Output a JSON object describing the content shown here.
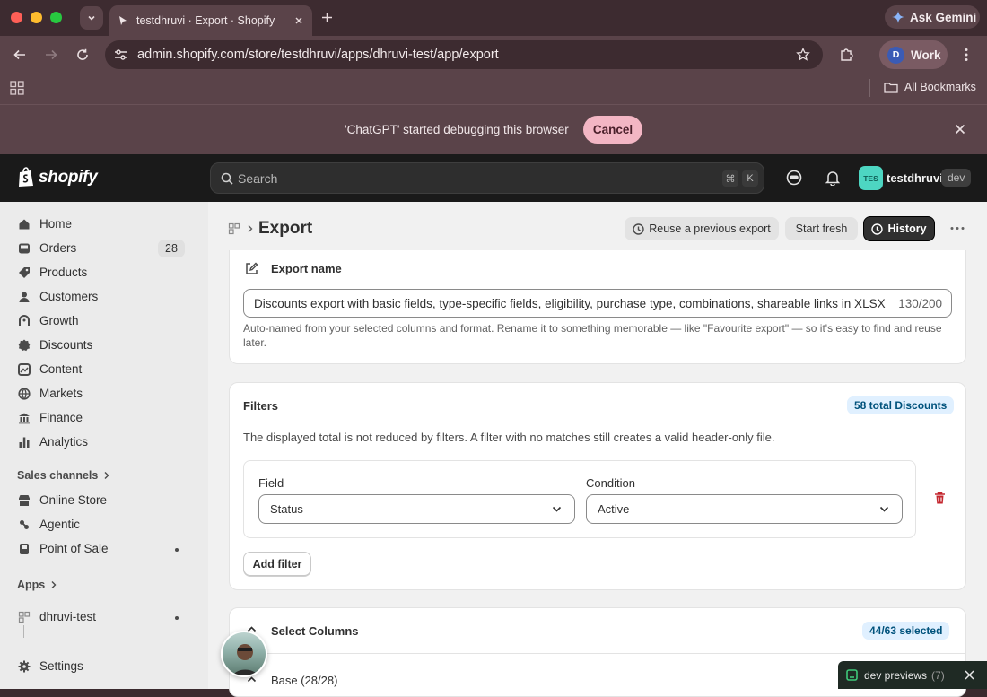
{
  "browser": {
    "tab_title": "testdhruvi · Export · Shopify",
    "url": "admin.shopify.com/store/testdhruvi/apps/dhruvi-test/app/export",
    "ask_gemini": "Ask Gemini",
    "profile_initial": "D",
    "profile_name": "Work",
    "bookmarks_label": "All Bookmarks",
    "debug_message": "'ChatGPT' started debugging this browser",
    "debug_cancel": "Cancel"
  },
  "shopify": {
    "logo_text": "shopify",
    "search_placeholder": "Search",
    "shortcut_cmd": "⌘",
    "shortcut_key": "K",
    "avatar_initials": "TES",
    "store_name": "testdhruvi",
    "dev_badge": "dev"
  },
  "sidebar": {
    "items": [
      {
        "label": "Home"
      },
      {
        "label": "Orders",
        "count": "28"
      },
      {
        "label": "Products"
      },
      {
        "label": "Customers"
      },
      {
        "label": "Growth"
      },
      {
        "label": "Discounts"
      },
      {
        "label": "Content"
      },
      {
        "label": "Markets"
      },
      {
        "label": "Finance"
      },
      {
        "label": "Analytics"
      }
    ],
    "sales_channels_heading": "Sales channels",
    "channels": [
      {
        "label": "Online Store"
      },
      {
        "label": "Agentic"
      },
      {
        "label": "Point of Sale"
      }
    ],
    "apps_heading": "Apps",
    "app_item": "dhruvi-test",
    "settings": "Settings"
  },
  "page": {
    "title": "Export",
    "reuse_button": "Reuse a previous export",
    "start_fresh_button": "Start fresh",
    "history_button": "History"
  },
  "export_name": {
    "heading": "Export name",
    "value": "Discounts export with basic fields, type-specific fields, eligibility, purchase type, combinations, shareable links in XLSX",
    "char_count": "130/200",
    "help": "Auto-named from your selected columns and format. Rename it to something memorable — like \"Favourite export\" — so it's easy to find and reuse later."
  },
  "filters": {
    "heading": "Filters",
    "total_badge": "58 total Discounts",
    "description": "The displayed total is not reduced by filters. A filter with no matches still creates a valid header-only file.",
    "field_label": "Field",
    "field_value": "Status",
    "condition_label": "Condition",
    "condition_value": "Active",
    "add_filter": "Add filter"
  },
  "columns": {
    "heading": "Select Columns",
    "selected_badge": "44/63 selected",
    "base_group": "Base (28/28)"
  },
  "dev_previews": {
    "label": "dev previews",
    "count": "(7)"
  },
  "colors": {
    "accent_pink": "#f3b6c4",
    "shop_header": "#1a1a1a",
    "sidebar_bg": "#ebebeb",
    "badge_blue": "#e0f0ff",
    "delete_red": "#c4262e"
  }
}
